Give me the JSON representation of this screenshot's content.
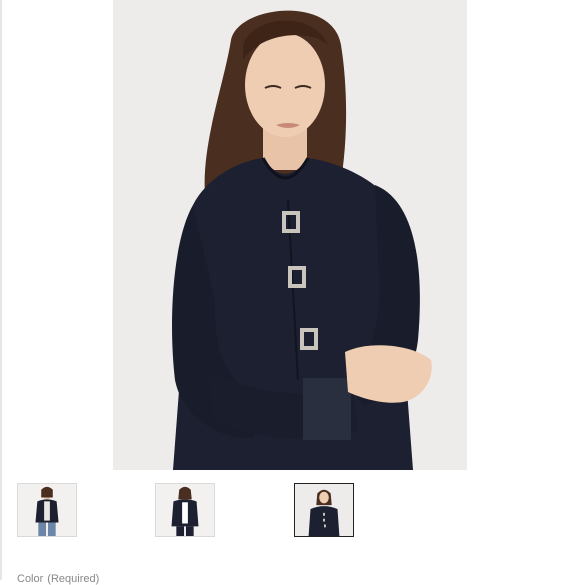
{
  "gallery": {
    "main_image": {
      "description_icon": "product-photo-model-navy-cardigan",
      "background_color": "#eeeceb",
      "garment_color": "#1c2030"
    },
    "thumbnails": [
      {
        "icon": "thumbnail-model-front-open",
        "selected": false
      },
      {
        "icon": "thumbnail-model-front-closed",
        "selected": false
      },
      {
        "icon": "thumbnail-model-close-up",
        "selected": true
      }
    ]
  },
  "options": {
    "color_label": "Color",
    "required_label": "(Required)"
  }
}
